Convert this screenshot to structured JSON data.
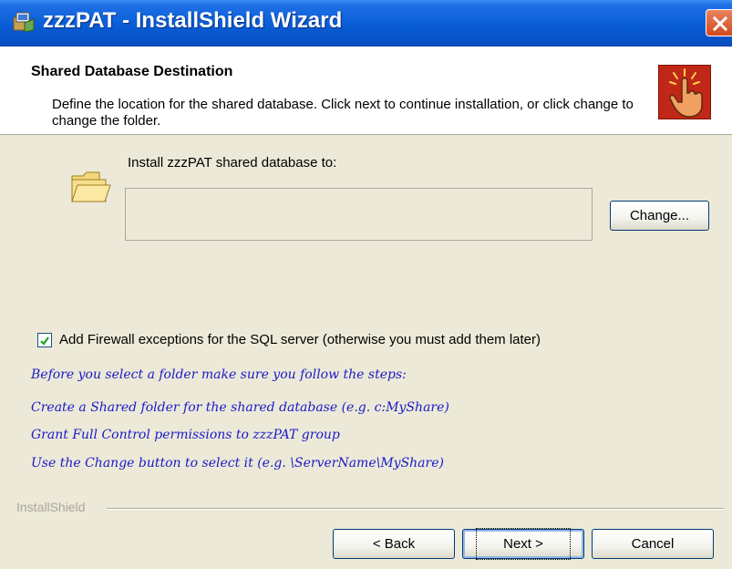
{
  "window": {
    "title": "zzzPAT - InstallShield Wizard",
    "icon": "installer-icon",
    "close_icon": "close-icon"
  },
  "header": {
    "title": "Shared Database Destination",
    "description": "Define the location for the shared database. Click next to continue installation, or click change to change the folder.",
    "image": "hand-click-icon"
  },
  "destination": {
    "label": "Install zzzPAT shared database to:",
    "path_value": "",
    "folder_icon": "folder-icon",
    "change_button": "Change..."
  },
  "firewall": {
    "checked": true,
    "label": "Add Firewall exceptions for the SQL server (otherwise you must add them later)"
  },
  "notes": [
    "Before you select a folder make sure you follow the steps:",
    "Create a Shared folder for the shared database (e.g. c:MyShare)",
    "Grant Full Control permissions to zzzPAT group",
    "Use the Change button to select it (e.g. \\ServerName\\MyShare)"
  ],
  "footer": {
    "brand": "InstallShield",
    "back_button": "< Back",
    "next_button": "Next >",
    "cancel_button": "Cancel"
  },
  "colors": {
    "titlebar": "#0a5fd8",
    "dialog_bg": "#ece9d8",
    "note_text": "#1a1ac8",
    "close_button": "#d2491c"
  }
}
